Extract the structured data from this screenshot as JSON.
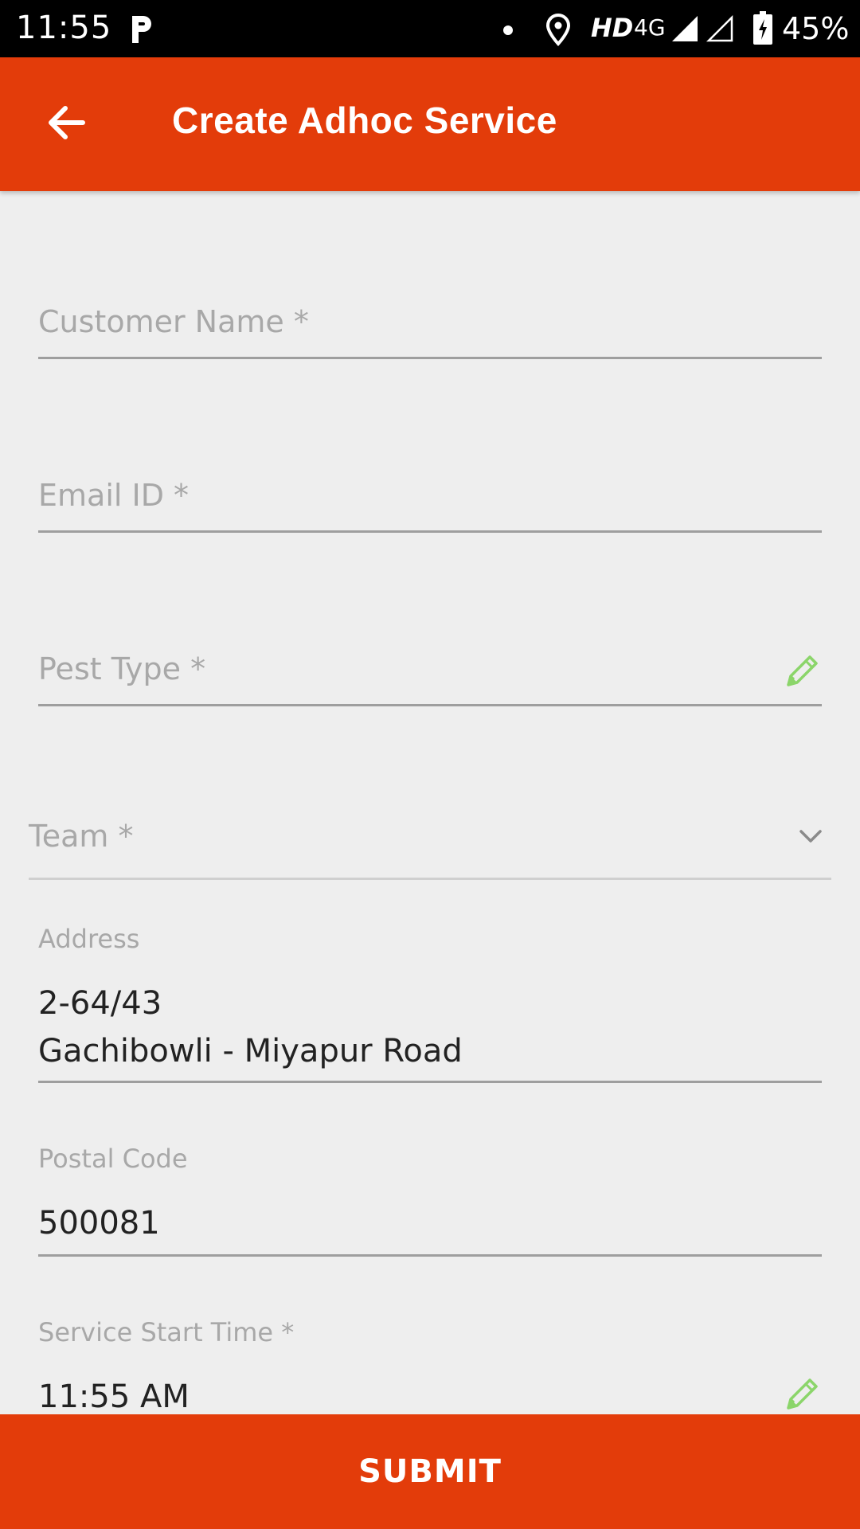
{
  "status_bar": {
    "time": "11:55",
    "network_label": "HD",
    "network_type": "4G",
    "battery": "45%",
    "icons": [
      "p-icon",
      "dot-icon",
      "location-icon",
      "signal-icon",
      "signal-empty-icon",
      "battery-charging-icon"
    ]
  },
  "app_bar": {
    "title": "Create Adhoc Service",
    "back_icon": "arrow-left-icon"
  },
  "form": {
    "customer_name": {
      "placeholder": "Customer Name *",
      "value": ""
    },
    "email": {
      "placeholder": "Email ID *",
      "value": ""
    },
    "pest_type": {
      "placeholder": "Pest Type *",
      "value": "",
      "icon": "pencil-icon"
    },
    "team": {
      "placeholder": "Team *",
      "selected": "",
      "icon": "chevron-down-icon"
    },
    "address": {
      "label": "Address",
      "line1": "2-64/43",
      "line2": "Gachibowli - Miyapur Road"
    },
    "postal_code": {
      "label": "Postal Code",
      "value": "500081"
    },
    "service_start_time": {
      "label": "Service Start Time *",
      "value": "11:55 AM",
      "icon": "pencil-icon"
    }
  },
  "submit": {
    "label": "SUBMIT"
  },
  "colors": {
    "primary": "#e33c0a",
    "background": "#eeeeee",
    "icon_accent": "#8bd56a"
  }
}
